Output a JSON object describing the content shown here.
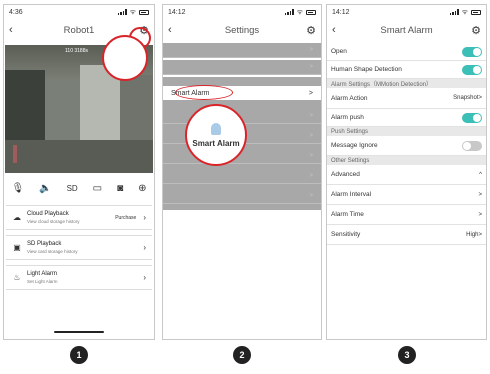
{
  "screen1": {
    "time": "4:36",
    "title": "Robot1",
    "video_timestamp": "110 3188s",
    "controls": [
      "mic-icon",
      "speaker-icon",
      "SD",
      "record-icon",
      "camera-icon",
      "ptz-icon"
    ],
    "sd_label": "SD",
    "cards": [
      {
        "icon": "cloud-icon",
        "title": "Cloud Playback",
        "sub": "View cloud storage history",
        "right": "Purchase"
      },
      {
        "icon": "sd-card-icon",
        "title": "SD Playback",
        "sub": "View card storage history",
        "right": ""
      },
      {
        "icon": "light-alarm-icon",
        "title": "Light Alarm",
        "sub": "Set Light Alarm",
        "right": ""
      }
    ]
  },
  "screen2": {
    "time": "14:12",
    "title": "Settings",
    "selected_item": "Smart Alarm",
    "zoom_label": "Smart Alarm",
    "chevron": ">"
  },
  "screen3": {
    "time": "14:12",
    "title": "Smart Alarm",
    "rows": {
      "open": "Open",
      "human_shape": "Human Shape Detection",
      "alarm_settings_header": "Alarm Settings（MMotion Detection）",
      "alarm_action": "Alarm Action",
      "alarm_action_value": "Snapshot>",
      "alarm_push": "Alarm push",
      "push_settings_header": "Push Settings",
      "message_ignore": "Message Ignore",
      "other_settings_header": "Other Settings",
      "advanced": "Advanced",
      "advanced_value": "^",
      "alarm_interval": "Alarm Interval",
      "alarm_interval_value": ">",
      "alarm_time": "Alarm Time",
      "alarm_time_value": ">",
      "sensitivity": "Sensitivity",
      "sensitivity_value": "High>"
    },
    "toggles": {
      "open": true,
      "human_shape": true,
      "alarm_push": true,
      "message_ignore": false
    },
    "toggle_on_color": "#3cbfb6"
  },
  "step_numbers": [
    "1",
    "2",
    "3"
  ],
  "accent_red": "#d9252a"
}
